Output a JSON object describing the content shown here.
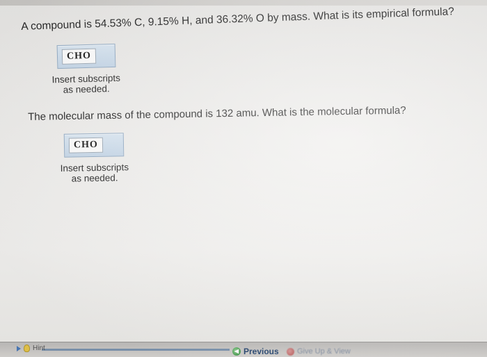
{
  "question1": {
    "text": "A compound is 54.53% C, 9.15% H,  and 36.32% O by mass. What is its empirical formula?",
    "answer_value": "CHO",
    "hint": [
      "Insert subscripts",
      "as needed."
    ]
  },
  "question2": {
    "text": "The molecular mass of the compound is 132 amu. What is the molecular formula?",
    "answer_value": "CHO",
    "hint": [
      "Insert subscripts",
      "as needed."
    ]
  },
  "footer": {
    "hint_label": "Hint",
    "previous_label": "Previous",
    "giveup_label": "Give Up & View"
  },
  "colors": {
    "answer_box_fill": "#c4d6e8",
    "answer_box_border": "#8fa9c4"
  }
}
